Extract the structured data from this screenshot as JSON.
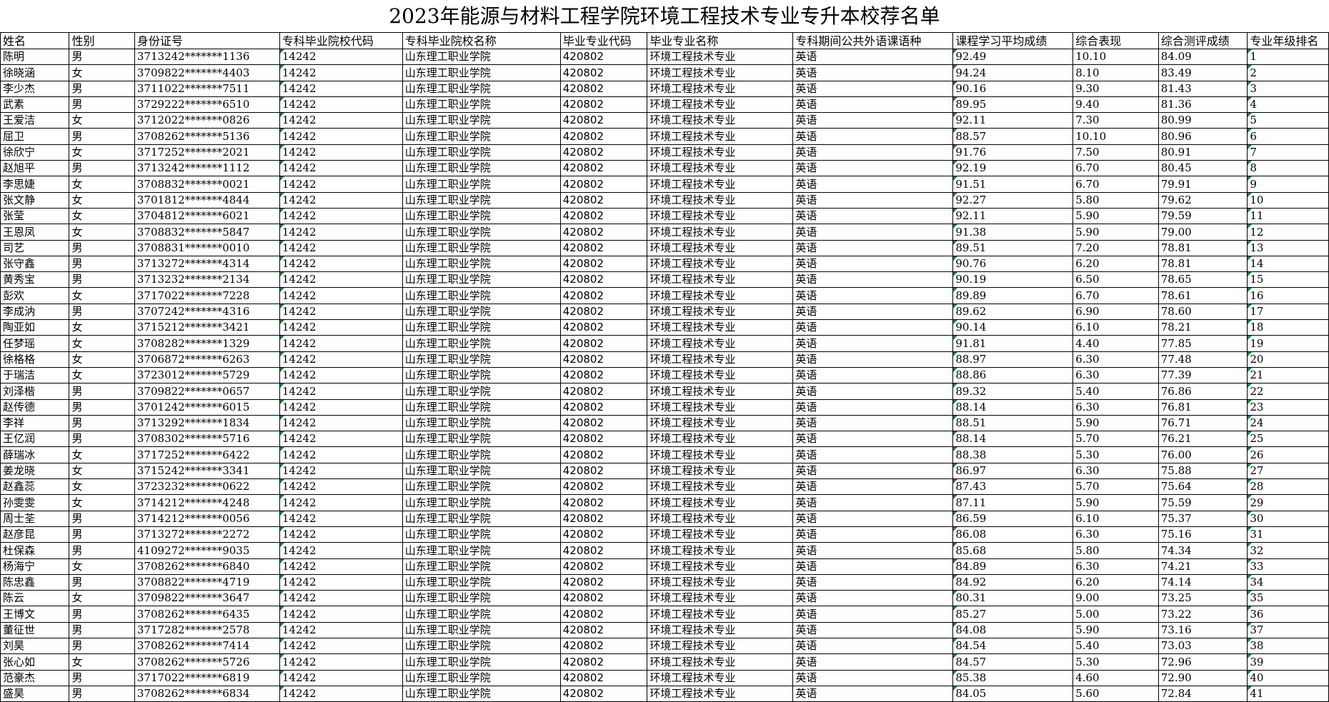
{
  "title": "2023年能源与材料工程学院环境工程技术专业专升本校荐名单",
  "columns": [
    "姓名",
    "性别",
    "身份证号",
    "专科毕业院校代码",
    "专科毕业院校名称",
    "毕业专业代码",
    "毕业专业名称",
    "专科期间公共外语课语种",
    "课程学习平均成绩",
    "综合表现",
    "综合测评成绩",
    "专业年级排名"
  ],
  "rows": [
    [
      "陈明",
      "男",
      "3713242*******1136",
      "14242",
      "山东理工职业学院",
      "420802",
      "环境工程技术专业",
      "英语",
      "92.49",
      "10.10",
      "84.09",
      "1"
    ],
    [
      "徐晓涵",
      "女",
      "3709822*******4403",
      "14242",
      "山东理工职业学院",
      "420802",
      "环境工程技术专业",
      "英语",
      "94.24",
      "8.10",
      "83.49",
      "2"
    ],
    [
      "李少杰",
      "男",
      "3711022*******7511",
      "14242",
      "山东理工职业学院",
      "420802",
      "环境工程技术专业",
      "英语",
      "90.16",
      "9.30",
      "81.43",
      "3"
    ],
    [
      "武素",
      "男",
      "3729222*******6510",
      "14242",
      "山东理工职业学院",
      "420802",
      "环境工程技术专业",
      "英语",
      "89.95",
      "9.40",
      "81.36",
      "4"
    ],
    [
      "王爱洁",
      "女",
      "3712022*******0826",
      "14242",
      "山东理工职业学院",
      "420802",
      "环境工程技术专业",
      "英语",
      "92.11",
      "7.30",
      "80.99",
      "5"
    ],
    [
      "屈卫",
      "男",
      "3708262*******5136",
      "14242",
      "山东理工职业学院",
      "420802",
      "环境工程技术专业",
      "英语",
      "88.57",
      "10.10",
      "80.96",
      "6"
    ],
    [
      "徐欣宁",
      "女",
      "3717252*******2021",
      "14242",
      "山东理工职业学院",
      "420802",
      "环境工程技术专业",
      "英语",
      "91.76",
      "7.50",
      "80.91",
      "7"
    ],
    [
      "赵旭平",
      "男",
      "3713242*******1112",
      "14242",
      "山东理工职业学院",
      "420802",
      "环境工程技术专业",
      "英语",
      "92.19",
      "6.70",
      "80.45",
      "8"
    ],
    [
      "李思婕",
      "女",
      "3708832*******0021",
      "14242",
      "山东理工职业学院",
      "420802",
      "环境工程技术专业",
      "英语",
      "91.51",
      "6.70",
      "79.91",
      "9"
    ],
    [
      "张文静",
      "女",
      "3701812*******4844",
      "14242",
      "山东理工职业学院",
      "420802",
      "环境工程技术专业",
      "英语",
      "92.27",
      "5.80",
      "79.62",
      "10"
    ],
    [
      "张莹",
      "女",
      "3704812*******6021",
      "14242",
      "山东理工职业学院",
      "420802",
      "环境工程技术专业",
      "英语",
      "92.11",
      "5.90",
      "79.59",
      "11"
    ],
    [
      "王恩凤",
      "女",
      "3708832*******5847",
      "14242",
      "山东理工职业学院",
      "420802",
      "环境工程技术专业",
      "英语",
      "91.38",
      "5.90",
      "79.00",
      "12"
    ],
    [
      "司艺",
      "男",
      "3708831*******0010",
      "14242",
      "山东理工职业学院",
      "420802",
      "环境工程技术专业",
      "英语",
      "89.51",
      "7.20",
      "78.81",
      "13"
    ],
    [
      "张守鑫",
      "男",
      "3713272*******4314",
      "14242",
      "山东理工职业学院",
      "420802",
      "环境工程技术专业",
      "英语",
      "90.76",
      "6.20",
      "78.81",
      "14"
    ],
    [
      "黄秀宝",
      "男",
      "3713232*******2134",
      "14242",
      "山东理工职业学院",
      "420802",
      "环境工程技术专业",
      "英语",
      "90.19",
      "6.50",
      "78.65",
      "15"
    ],
    [
      "彭欢",
      "女",
      "3717022*******7228",
      "14242",
      "山东理工职业学院",
      "420802",
      "环境工程技术专业",
      "英语",
      "89.89",
      "6.70",
      "78.61",
      "16"
    ],
    [
      "李成汭",
      "男",
      "3707242*******4316",
      "14242",
      "山东理工职业学院",
      "420802",
      "环境工程技术专业",
      "英语",
      "89.62",
      "6.90",
      "78.60",
      "17"
    ],
    [
      "陶亚如",
      "女",
      "3715212*******3421",
      "14242",
      "山东理工职业学院",
      "420802",
      "环境工程技术专业",
      "英语",
      "90.14",
      "6.10",
      "78.21",
      "18"
    ],
    [
      "任梦瑶",
      "女",
      "3708282*******1329",
      "14242",
      "山东理工职业学院",
      "420802",
      "环境工程技术专业",
      "英语",
      "91.81",
      "4.40",
      "77.85",
      "19"
    ],
    [
      "徐格格",
      "女",
      "3706872*******6263",
      "14242",
      "山东理工职业学院",
      "420802",
      "环境工程技术专业",
      "英语",
      "88.97",
      "6.30",
      "77.48",
      "20"
    ],
    [
      "于瑞洁",
      "女",
      "3723012*******5729",
      "14242",
      "山东理工职业学院",
      "420802",
      "环境工程技术专业",
      "英语",
      "88.86",
      "6.30",
      "77.39",
      "21"
    ],
    [
      "刘泽楷",
      "男",
      "3709822*******0657",
      "14242",
      "山东理工职业学院",
      "420802",
      "环境工程技术专业",
      "英语",
      "89.32",
      "5.40",
      "76.86",
      "22"
    ],
    [
      "赵传德",
      "男",
      "3701242*******6015",
      "14242",
      "山东理工职业学院",
      "420802",
      "环境工程技术专业",
      "英语",
      "88.14",
      "6.30",
      "76.81",
      "23"
    ],
    [
      "李祥",
      "男",
      "3713292*******1834",
      "14242",
      "山东理工职业学院",
      "420802",
      "环境工程技术专业",
      "英语",
      "88.51",
      "5.90",
      "76.71",
      "24"
    ],
    [
      "王亿润",
      "男",
      "3708302*******5716",
      "14242",
      "山东理工职业学院",
      "420802",
      "环境工程技术专业",
      "英语",
      "88.14",
      "5.70",
      "76.21",
      "25"
    ],
    [
      "薛瑞冰",
      "女",
      "3717252*******6422",
      "14242",
      "山东理工职业学院",
      "420802",
      "环境工程技术专业",
      "英语",
      "88.38",
      "5.30",
      "76.00",
      "26"
    ],
    [
      "姜龙晓",
      "女",
      "3715242*******3341",
      "14242",
      "山东理工职业学院",
      "420802",
      "环境工程技术专业",
      "英语",
      "86.97",
      "6.30",
      "75.88",
      "27"
    ],
    [
      "赵鑫蕊",
      "女",
      "3723232*******0622",
      "14242",
      "山东理工职业学院",
      "420802",
      "环境工程技术专业",
      "英语",
      "87.43",
      "5.70",
      "75.64",
      "28"
    ],
    [
      "孙雯雯",
      "女",
      "3714212*******4248",
      "14242",
      "山东理工职业学院",
      "420802",
      "环境工程技术专业",
      "英语",
      "87.11",
      "5.90",
      "75.59",
      "29"
    ],
    [
      "周士荃",
      "男",
      "3714212*******0056",
      "14242",
      "山东理工职业学院",
      "420802",
      "环境工程技术专业",
      "英语",
      "86.59",
      "6.10",
      "75.37",
      "30"
    ],
    [
      "赵彦昆",
      "男",
      "3713272*******2272",
      "14242",
      "山东理工职业学院",
      "420802",
      "环境工程技术专业",
      "英语",
      "86.08",
      "6.30",
      "75.16",
      "31"
    ],
    [
      "杜保森",
      "男",
      "4109272*******9035",
      "14242",
      "山东理工职业学院",
      "420802",
      "环境工程技术专业",
      "英语",
      "85.68",
      "5.80",
      "74.34",
      "32"
    ],
    [
      "杨海宁",
      "女",
      "3708262*******6840",
      "14242",
      "山东理工职业学院",
      "420802",
      "环境工程技术专业",
      "英语",
      "84.89",
      "6.30",
      "74.21",
      "33"
    ],
    [
      "陈忠鑫",
      "男",
      "3708822*******4719",
      "14242",
      "山东理工职业学院",
      "420802",
      "环境工程技术专业",
      "英语",
      "84.92",
      "6.20",
      "74.14",
      "34"
    ],
    [
      "陈云",
      "女",
      "3709822*******3647",
      "14242",
      "山东理工职业学院",
      "420802",
      "环境工程技术专业",
      "英语",
      "80.31",
      "9.00",
      "73.25",
      "35"
    ],
    [
      "王博文",
      "男",
      "3708262*******6435",
      "14242",
      "山东理工职业学院",
      "420802",
      "环境工程技术专业",
      "英语",
      "85.27",
      "5.00",
      "73.22",
      "36"
    ],
    [
      "董征世",
      "男",
      "3717282*******2578",
      "14242",
      "山东理工职业学院",
      "420802",
      "环境工程技术专业",
      "英语",
      "84.08",
      "5.90",
      "73.16",
      "37"
    ],
    [
      "刘昊",
      "男",
      "3708262*******7414",
      "14242",
      "山东理工职业学院",
      "420802",
      "环境工程技术专业",
      "英语",
      "84.54",
      "5.40",
      "73.03",
      "38"
    ],
    [
      "张心如",
      "女",
      "3708262*******5726",
      "14242",
      "山东理工职业学院",
      "420802",
      "环境工程技术专业",
      "英语",
      "84.57",
      "5.30",
      "72.96",
      "39"
    ],
    [
      "范豪杰",
      "男",
      "3717022*******6819",
      "14242",
      "山东理工职业学院",
      "420802",
      "环境工程技术专业",
      "英语",
      "85.38",
      "4.60",
      "72.90",
      "40"
    ],
    [
      "盛昊",
      "男",
      "3708262*******6834",
      "14242",
      "山东理工职业学院",
      "420802",
      "环境工程技术专业",
      "英语",
      "84.05",
      "5.60",
      "72.84",
      "41"
    ]
  ]
}
